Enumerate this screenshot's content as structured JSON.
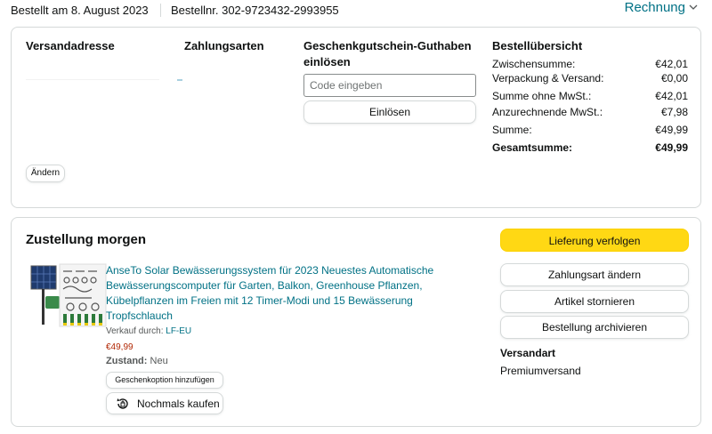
{
  "header": {
    "order_date": "Bestellt am 8. August 2023",
    "order_number": "Bestellnr. 302-9723432-2993955",
    "invoice_link": "Rechnung",
    "invoice_chevron": "chevron-down-icon"
  },
  "summary_card": {
    "shipping_address_title": "Versandadresse",
    "payment_methods_title": "Zahlungsarten",
    "voucher_title": "Geschenkgutschein-Guthaben einlösen",
    "voucher_placeholder": "Code eingeben",
    "redeem_button": "Einlösen",
    "change_button": "Ändern",
    "order_overview_title": "Bestellübersicht",
    "rows": [
      {
        "label": "Zwischensumme:",
        "value": "€42,01"
      },
      {
        "label": "Verpackung & Versand:",
        "value": "€0,00"
      },
      {
        "label": "Summe ohne MwSt.:",
        "value": "€42,01"
      },
      {
        "label": "Anzurechnende MwSt.:",
        "value": "€7,98"
      },
      {
        "label": "Summe:",
        "value": "€49,99"
      },
      {
        "label": "Gesamtsumme:",
        "value": "€49,99"
      }
    ]
  },
  "delivery_card": {
    "title": "Zustellung morgen",
    "product": {
      "title": "AnseTo Solar Bewässerungssystem für 2023 Neuestes Automatische Bewässerungscomputer für Garten, Balkon, Greenhouse Pflanzen, Kübelpflanzen im Freien mit 12 Timer-Modi und 15 Bewässerung Tropfschlauch",
      "seller_prefix": "Verkauf durch:",
      "seller_name": "LF-EU",
      "price": "€49,99",
      "condition_label": "Zustand:",
      "condition_value": "Neu",
      "gift_option_button": "Geschenkoption hinzufügen",
      "buy_again_button": "Nochmals kaufen"
    },
    "actions": {
      "track": "Lieferung verfolgen",
      "change_payment": "Zahlungsart ändern",
      "cancel_item": "Artikel stornieren",
      "archive_order": "Bestellung archivieren"
    },
    "shipping_method_label": "Versandart",
    "shipping_method_value": "Premiumversand"
  },
  "colors": {
    "link": "#007185",
    "price": "#b12704",
    "primary_button": "#ffd814",
    "border": "#d5d9d9"
  }
}
